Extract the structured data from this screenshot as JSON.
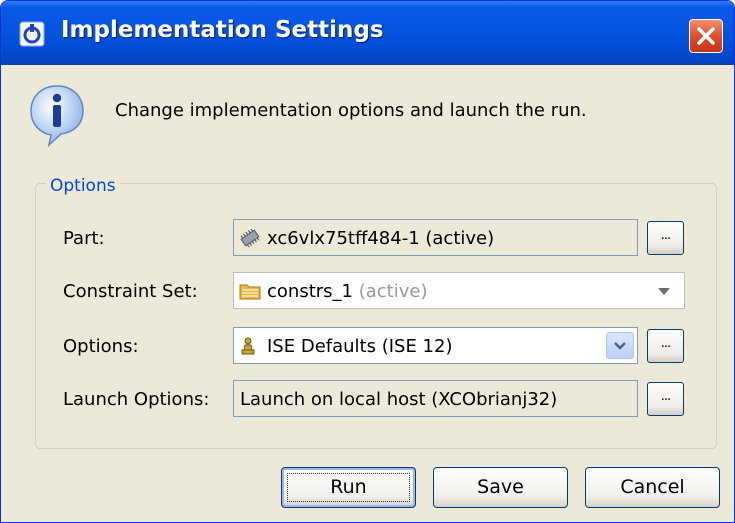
{
  "dialog": {
    "title": "Implementation Settings",
    "message": "Change implementation options and launch the run."
  },
  "options": {
    "legend": "Options",
    "part": {
      "label": "Part:",
      "value": "xc6vlx75tff484-1 (active)"
    },
    "constraint_set": {
      "label": "Constraint Set:",
      "value": "constrs_1",
      "suffix": "(active)"
    },
    "strategy": {
      "label": "Options:",
      "value": "ISE Defaults (ISE 12)"
    },
    "launch": {
      "label": "Launch Options:",
      "value": "Launch on local host (XCObrianj32)"
    },
    "more_button": "..."
  },
  "buttons": {
    "run": "Run",
    "save": "Save",
    "cancel": "Cancel"
  },
  "colors": {
    "titlebar": "#0454e0",
    "window_bg": "#ece9d8",
    "close": "#dc4a25",
    "legend": "#0046d5"
  },
  "icons": {
    "app": "vivado-app-icon",
    "info": "info-icon",
    "part": "chip-icon",
    "constraint": "folder-icon",
    "strategy": "chess-pawn-icon",
    "close": "close-icon"
  }
}
